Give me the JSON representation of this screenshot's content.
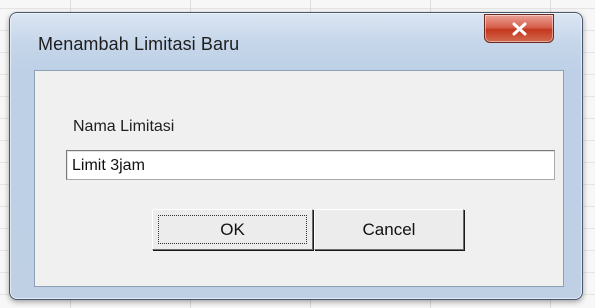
{
  "dialog": {
    "title": "Menambah Limitasi Baru",
    "close_icon": "close-icon",
    "field_label": "Nama Limitasi",
    "field_value": "Limit 3jam",
    "ok_label": "OK",
    "cancel_label": "Cancel"
  },
  "colors": {
    "close_button": "#c3381f",
    "frame": "#bfd0e4",
    "client_area": "#f0f0f0"
  }
}
